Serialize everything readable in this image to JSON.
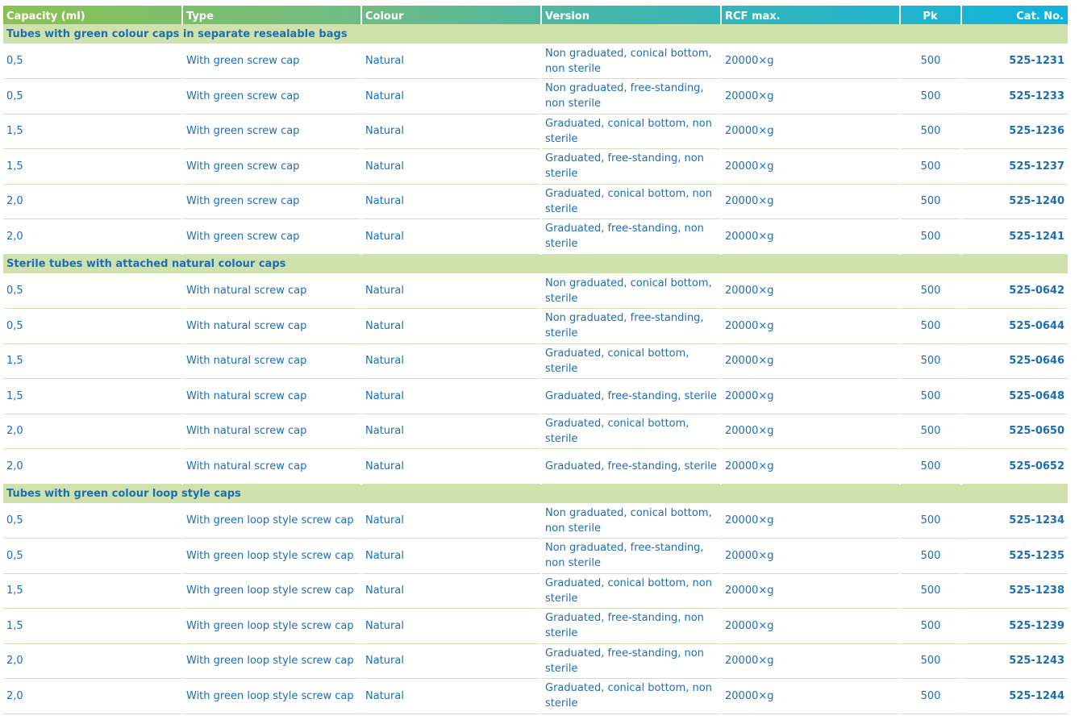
{
  "headers": [
    "Capacity (ml)",
    "Type",
    "Colour",
    "Version",
    "RCF max.",
    "Pk",
    "Cat. No."
  ],
  "groups": [
    {
      "title": "Tubes with green colour caps in separate resealable bags",
      "rows": [
        [
          "0,5",
          "With green screw cap",
          "Natural",
          "Non graduated, conical bottom, non sterile",
          "20000×g",
          "500",
          "525-1231"
        ],
        [
          "0,5",
          "With green screw cap",
          "Natural",
          "Non graduated, free-standing, non sterile",
          "20000×g",
          "500",
          "525-1233"
        ],
        [
          "1,5",
          "With green screw cap",
          "Natural",
          "Graduated, conical bottom, non sterile",
          "20000×g",
          "500",
          "525-1236"
        ],
        [
          "1,5",
          "With green screw cap",
          "Natural",
          "Graduated, free-standing, non sterile",
          "20000×g",
          "500",
          "525-1237"
        ],
        [
          "2,0",
          "With green screw cap",
          "Natural",
          "Graduated, conical bottom, non sterile",
          "20000×g",
          "500",
          "525-1240"
        ],
        [
          "2,0",
          "With green screw cap",
          "Natural",
          "Graduated, free-standing, non sterile",
          "20000×g",
          "500",
          "525-1241"
        ]
      ]
    },
    {
      "title": "Sterile tubes with attached natural colour caps",
      "rows": [
        [
          "0,5",
          "With natural screw cap",
          "Natural",
          "Non graduated, conical bottom, sterile",
          "20000×g",
          "500",
          "525-0642"
        ],
        [
          "0,5",
          "With natural screw cap",
          "Natural",
          "Non graduated, free-standing, sterile",
          "20000×g",
          "500",
          "525-0644"
        ],
        [
          "1,5",
          "With natural screw cap",
          "Natural",
          "Graduated, conical bottom, sterile",
          "20000×g",
          "500",
          "525-0646"
        ],
        [
          "1,5",
          "With natural screw cap",
          "Natural",
          "Graduated, free-standing, sterile",
          "20000×g",
          "500",
          "525-0648"
        ],
        [
          "2,0",
          "With natural screw cap",
          "Natural",
          "Graduated, conical bottom, sterile",
          "20000×g",
          "500",
          "525-0650"
        ],
        [
          "2,0",
          "With natural screw cap",
          "Natural",
          "Graduated, free-standing, sterile",
          "20000×g",
          "500",
          "525-0652"
        ]
      ]
    },
    {
      "title": "Tubes with green colour loop style caps",
      "rows": [
        [
          "0,5",
          "With green loop style screw cap",
          "Natural",
          "Non graduated, conical bottom, non sterile",
          "20000×g",
          "500",
          "525-1234"
        ],
        [
          "0,5",
          "With green loop style screw cap",
          "Natural",
          "Non graduated, free-standing, non sterile",
          "20000×g",
          "500",
          "525-1235"
        ],
        [
          "1,5",
          "With green loop style screw cap",
          "Natural",
          "Graduated, conical bottom, non sterile",
          "20000×g",
          "500",
          "525-1238"
        ],
        [
          "1,5",
          "With green loop style screw cap",
          "Natural",
          "Graduated, free-standing, non sterile",
          "20000×g",
          "500",
          "525-1239"
        ],
        [
          "2,0",
          "With green loop style screw cap",
          "Natural",
          "Graduated, free-standing, non sterile",
          "20000×g",
          "500",
          "525-1243"
        ],
        [
          "2,0",
          "With green loop style screw cap",
          "Natural",
          "Graduated, conical bottom, non sterile",
          "20000×g",
          "500",
          "525-1244"
        ]
      ]
    }
  ]
}
